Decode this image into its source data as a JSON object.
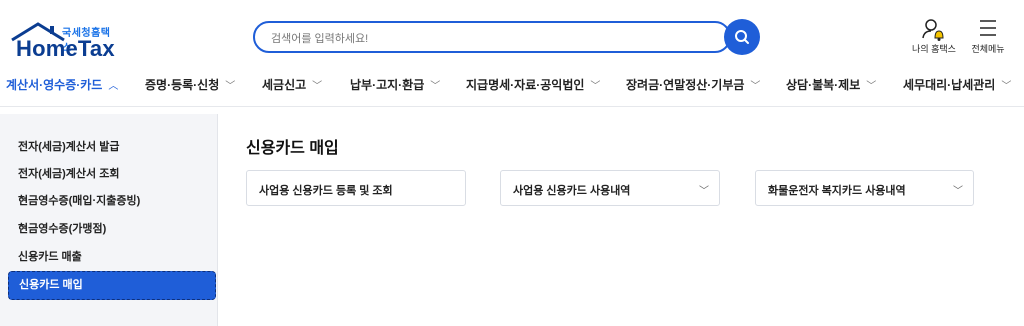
{
  "header": {
    "logo_top": "국세청홈택스",
    "logo_main": "HomeTax",
    "search_placeholder": "검색어를 입력하세요!",
    "util_my": "나의 홈택스",
    "util_menu": "전체메뉴"
  },
  "nav": {
    "items": [
      {
        "label": "계산서·영수증·카드",
        "chevron": "^"
      },
      {
        "label": "증명·등록·신청",
        "chevron": "v"
      },
      {
        "label": "세금신고",
        "chevron": "v"
      },
      {
        "label": "납부·고지·환급",
        "chevron": "v"
      },
      {
        "label": "지급명세·자료·공익법인",
        "chevron": "v"
      },
      {
        "label": "장려금·연말정산·기부금",
        "chevron": "v"
      },
      {
        "label": "상담·불복·제보",
        "chevron": "v"
      },
      {
        "label": "세무대리·납세관리",
        "chevron": "v"
      }
    ],
    "active_index": 0
  },
  "sidebar": {
    "items": [
      {
        "label": "전자(세금)계산서 발급"
      },
      {
        "label": "전자(세금)계산서 조회"
      },
      {
        "label": "현금영수증(매입·지출증빙)"
      },
      {
        "label": "현금영수증(가맹점)"
      },
      {
        "label": "신용카드 매출"
      },
      {
        "label": "신용카드 매입"
      }
    ],
    "active_index": 5
  },
  "main": {
    "title": "신용카드 매입",
    "cards": [
      {
        "label": "사업용 신용카드 등록 및 조회"
      },
      {
        "label": "사업용 신용카드 사용내역",
        "chevron": "v"
      },
      {
        "label": "화물운전자 복지카드 사용내역",
        "chevron": "v"
      }
    ]
  },
  "colors": {
    "accent": "#1f5ed8",
    "brand_dark": "#0b3d91",
    "sidebar_bg": "#f4f5f8",
    "bell": "#f5c400"
  },
  "icons": {
    "search": "search-icon",
    "user": "user-bell-icon",
    "menu": "hamburger-menu-icon",
    "chevron_down": "chevron-down-icon",
    "chevron_up": "chevron-up-icon"
  }
}
